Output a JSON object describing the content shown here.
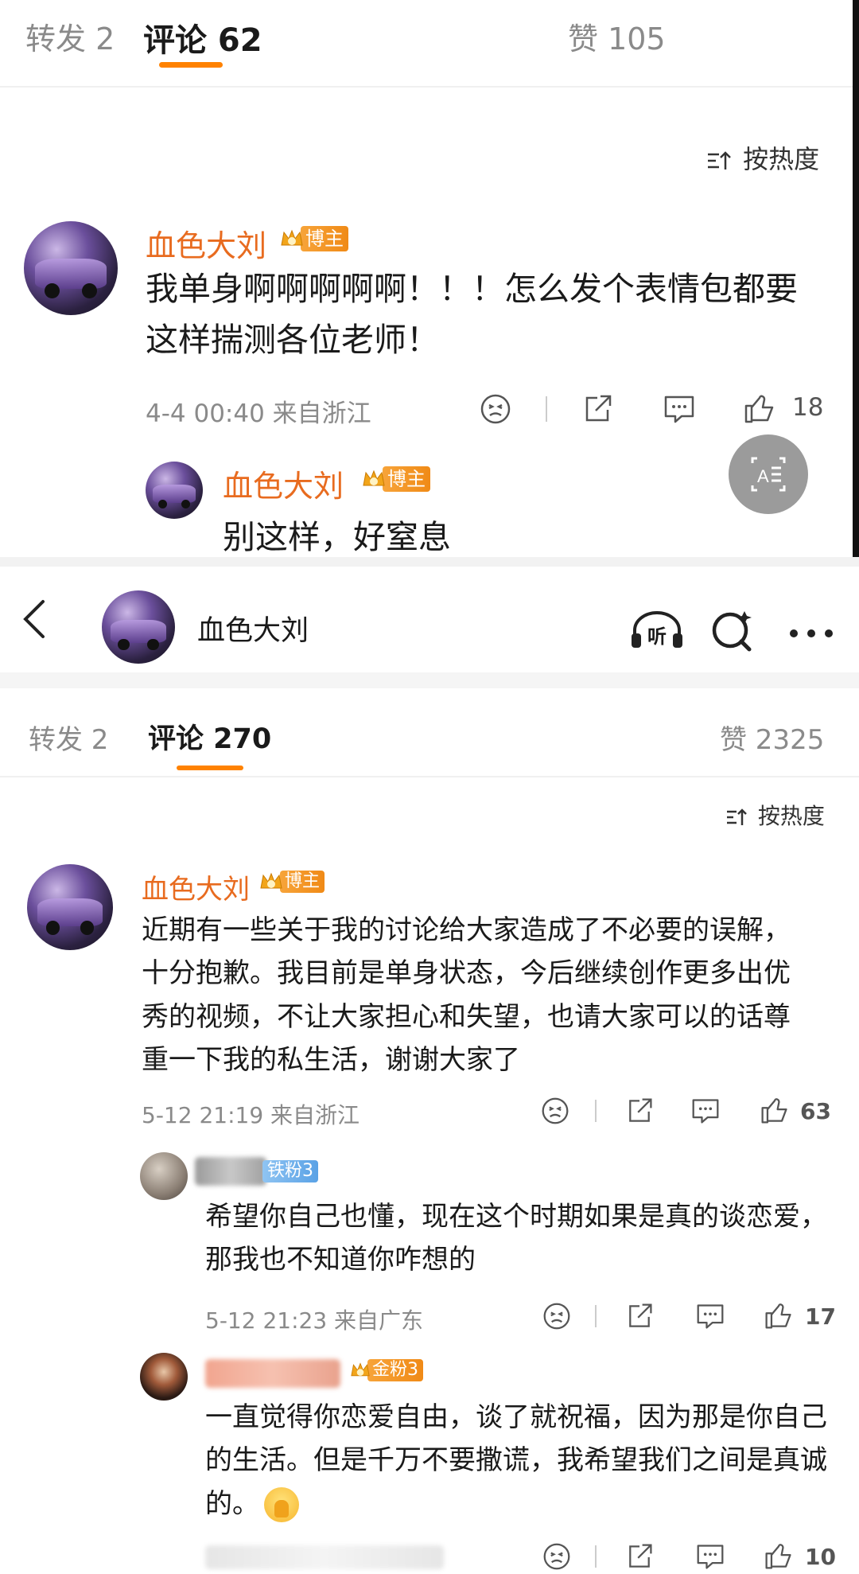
{
  "screen1": {
    "tabs": {
      "repost": "转发 2",
      "comments": "评论 62",
      "likes": "赞 105"
    },
    "sort_label": "按热度",
    "comment": {
      "author": "血色大刘",
      "badge": "博主",
      "text": "我单身啊啊啊啊啊！！！怎么发个表情包都要这样揣测各位老师！",
      "time_location": "4-4 00:40 来自浙江",
      "like_count": "18"
    },
    "reply": {
      "author": "血色大刘",
      "badge": "博主",
      "text": "别这样，好窒息"
    }
  },
  "screen2": {
    "header": {
      "title": "血色大刘",
      "listen_label": "听"
    },
    "tabs": {
      "repost": "转发 2",
      "comments": "评论 270",
      "likes": "赞 2325"
    },
    "sort_label": "按热度",
    "comment": {
      "author": "血色大刘",
      "badge": "博主",
      "text": "近期有一些关于我的讨论给大家造成了不必要的误解，十分抱歉。我目前是单身状态，今后继续创作更多出优秀的视频，不让大家担心和失望，也请大家可以的话尊重一下我的私生活，谢谢大家了",
      "time_location": "5-12 21:19 来自浙江",
      "like_count": "63"
    },
    "replies": [
      {
        "badge": "铁粉3",
        "text": "希望你自己也懂，现在这个时期如果是真的谈恋爱，那我也不知道你咋想的",
        "time_location": "5-12 21:23 来自广东",
        "like_count": "17"
      },
      {
        "badge": "金粉3",
        "text": "一直觉得你恋爱自由，谈了就祝福，因为那是你自己的生活。但是千万不要撒谎，我希望我们之间是真诚的。",
        "like_count": "10"
      }
    ]
  },
  "colors": {
    "accent": "#ff8200",
    "name": "#e86b1f",
    "muted": "#8a8a8a"
  },
  "icons": [
    "sort-icon",
    "emoji-icon",
    "share-icon",
    "comment-icon",
    "like-icon",
    "translate-icon",
    "back-icon",
    "listen-icon",
    "search-icon",
    "more-icon",
    "praying-emoji"
  ]
}
